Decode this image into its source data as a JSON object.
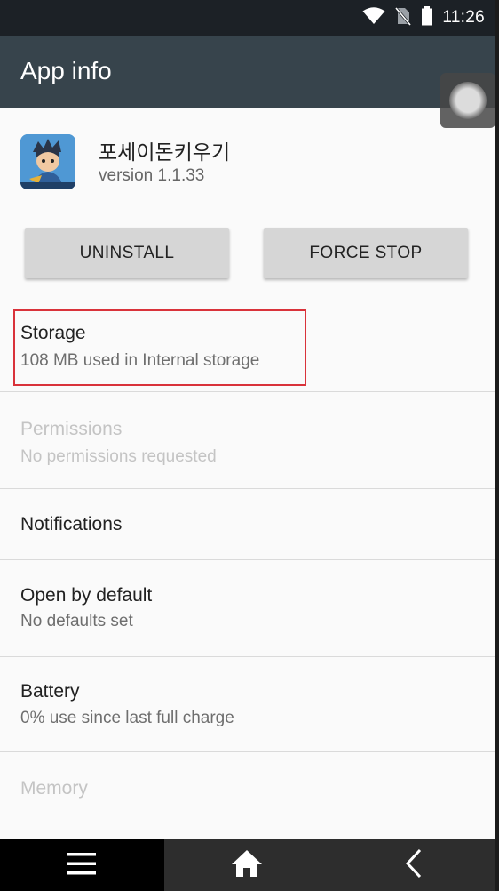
{
  "status_bar": {
    "time": "11:26",
    "icons": [
      "wifi-icon",
      "no-sim-icon",
      "battery-icon"
    ]
  },
  "toolbar": {
    "title": "App info"
  },
  "app": {
    "name": "포세이돈키우기",
    "version": "version 1.1.33",
    "icon": "app-icon"
  },
  "actions": {
    "uninstall_label": "UNINSTALL",
    "force_stop_label": "FORCE STOP"
  },
  "settings": {
    "storage": {
      "title": "Storage",
      "subtitle": "108 MB used in Internal storage"
    },
    "permissions": {
      "title": "Permissions",
      "subtitle": "No permissions requested"
    },
    "notifications": {
      "title": "Notifications"
    },
    "open_by_default": {
      "title": "Open by default",
      "subtitle": "No defaults set"
    },
    "battery": {
      "title": "Battery",
      "subtitle": "0% use since last full charge"
    },
    "memory": {
      "title": "Memory"
    }
  },
  "highlight_color": "#d9323a",
  "nav_bar": {
    "items": [
      "menu-icon",
      "home-icon",
      "back-icon"
    ]
  }
}
